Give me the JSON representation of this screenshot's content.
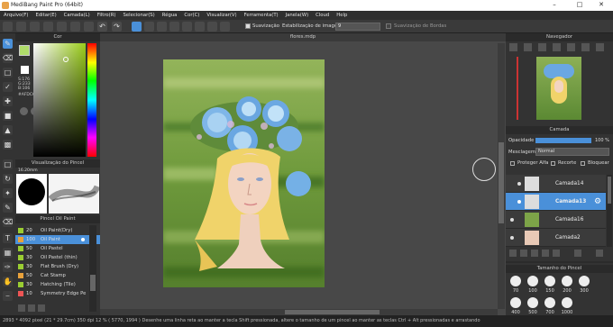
{
  "window": {
    "title": "MediBang Paint Pro (64bit)"
  },
  "menu": [
    "Arquivo(F)",
    "Editar(E)",
    "Camada(L)",
    "Filtro(R)",
    "Selecionar(S)",
    "Régua",
    "Cor(C)",
    "Visualizar(V)",
    "Ferramenta(T)",
    "Janela(W)",
    "Cloud",
    "Help"
  ],
  "toolbar": {
    "smoothing_label": "Suavização",
    "stabilization_label": "Estabilização de imagem",
    "stabilization_value": "9",
    "border_smoothing_label": "Suavização de Bordas"
  },
  "color_panel": {
    "title": "Cor",
    "s": "S:176",
    "v": "G:233",
    "b": "B:106",
    "hex": "#AFDC6A"
  },
  "brush_preview": {
    "title": "Visualização do Pincel",
    "size": "16.20mm"
  },
  "brush_panel": {
    "title": "Pincel Oil Paint",
    "items": [
      {
        "size": "20",
        "name": "Oil Paint(Dry)",
        "color": "#9acd32"
      },
      {
        "size": "100",
        "name": "Oil Paint",
        "color": "#e9a23b"
      },
      {
        "size": "50",
        "name": "Oil Pastel",
        "color": "#9acd32"
      },
      {
        "size": "30",
        "name": "Oil Pastel (thin)",
        "color": "#9acd32"
      },
      {
        "size": "30",
        "name": "Flat Brush (Dry)",
        "color": "#9acd32"
      },
      {
        "size": "50",
        "name": "Cat Stamp",
        "color": "#e9a23b"
      },
      {
        "size": "30",
        "name": "Hatching (Tile)",
        "color": "#9acd32"
      },
      {
        "size": "10",
        "name": "Symmetry Edge Pe",
        "color": "#e55"
      }
    ]
  },
  "document": {
    "tab": "flores.mdp"
  },
  "navigator": {
    "title": "Navegador"
  },
  "layers": {
    "title": "Camada",
    "opacity_label": "Opacidade",
    "opacity_value": "100 %",
    "blend_label": "Mesclagem",
    "blend_value": "Normal",
    "protect_alpha": "Proteger Alfa",
    "clip": "Recorte",
    "lock": "Bloquear",
    "items": [
      {
        "name": "Camada14"
      },
      {
        "name": "Camada13"
      },
      {
        "name": "Camada16"
      },
      {
        "name": "Camada2"
      }
    ]
  },
  "brush_size": {
    "title": "Tamanho do Pincel",
    "sizes": [
      "70",
      "100",
      "150",
      "200",
      "300",
      "400",
      "500",
      "700",
      "1000"
    ]
  },
  "status": {
    "text": "2893 * 4092 pixel   (21 * 29.7cm)   350 dpi   12 %   ( 5770, 1994 )   Desenhe uma linha reta ao manter a tecla Shift pressionada, altere o tamanho de um pincel ao manter as teclas Ctrl + Alt pressionadas e arrastando"
  }
}
